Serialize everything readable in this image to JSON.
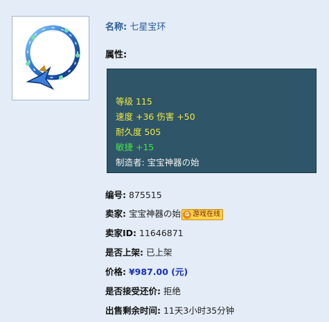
{
  "item": {
    "name_label": "名称:",
    "name": "七星宝环",
    "attributes_label": "属性:"
  },
  "attributes": [
    {
      "text": "等级 115",
      "color": "yellow"
    },
    {
      "text": "速度 +36 伤害 +50",
      "color": "yellow"
    },
    {
      "text": "耐久度 505",
      "color": "yellow"
    },
    {
      "text": "敏捷 +15",
      "color": "green"
    },
    {
      "text": "制造者: 宝宝神器の始",
      "color": "white"
    }
  ],
  "details": {
    "id_label": "编号:",
    "id_value": "875515",
    "seller_label": "卖家:",
    "seller_value": "宝宝神器の始",
    "online_badge": "游戏在线",
    "seller_id_label": "卖家ID:",
    "seller_id_value": "11646871",
    "listed_label": "是否上架:",
    "listed_value": "已上架",
    "price_label": "价格:",
    "price_value": "¥987.00 (元)",
    "counter_label": "是否接受还价:",
    "counter_value": "拒绝",
    "time_label": "出售剩余时间:",
    "time_value": "11天3小时35分钟"
  },
  "icons": {
    "item_image": "ring-icon",
    "online_badge_icon": "game-online-icon"
  },
  "colors": {
    "page_bg": "#e3ecf7",
    "attr_box_bg": "#2f5568",
    "attr_yellow": "#f0ea40",
    "attr_green": "#43e843",
    "price_blue": "#1a2fb0"
  }
}
